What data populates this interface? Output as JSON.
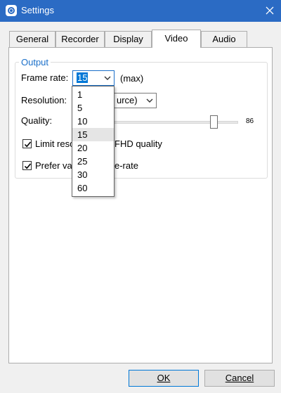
{
  "window": {
    "title": "Settings"
  },
  "tabs": [
    {
      "label": "General"
    },
    {
      "label": "Recorder"
    },
    {
      "label": "Display"
    },
    {
      "label": "Video",
      "active": true
    },
    {
      "label": "Audio"
    }
  ],
  "output_group": {
    "legend": "Output",
    "frame_rate": {
      "label": "Frame rate:",
      "value": "15",
      "suffix": "(max)"
    },
    "resolution": {
      "label": "Resolution:",
      "value_visible_fragment": "urce)"
    },
    "quality": {
      "label": "Quality:",
      "value": 86,
      "max": 100
    },
    "limit_resolution": {
      "label_visible_start": "Limit reso",
      "label_visible_end": "FHD quality",
      "checked": true
    },
    "prefer_variable": {
      "label_visible_start": "Prefer var",
      "label_visible_end": "e-rate",
      "checked": true
    }
  },
  "frame_rate_dropdown": {
    "options": [
      "1",
      "5",
      "10",
      "15",
      "20",
      "25",
      "30",
      "60"
    ],
    "highlighted": "15"
  },
  "buttons": {
    "ok": "OK",
    "cancel": "Cancel"
  },
  "colors": {
    "titlebar": "#2b6bc4",
    "accent": "#1a6fc9",
    "selection": "#0078d7"
  }
}
